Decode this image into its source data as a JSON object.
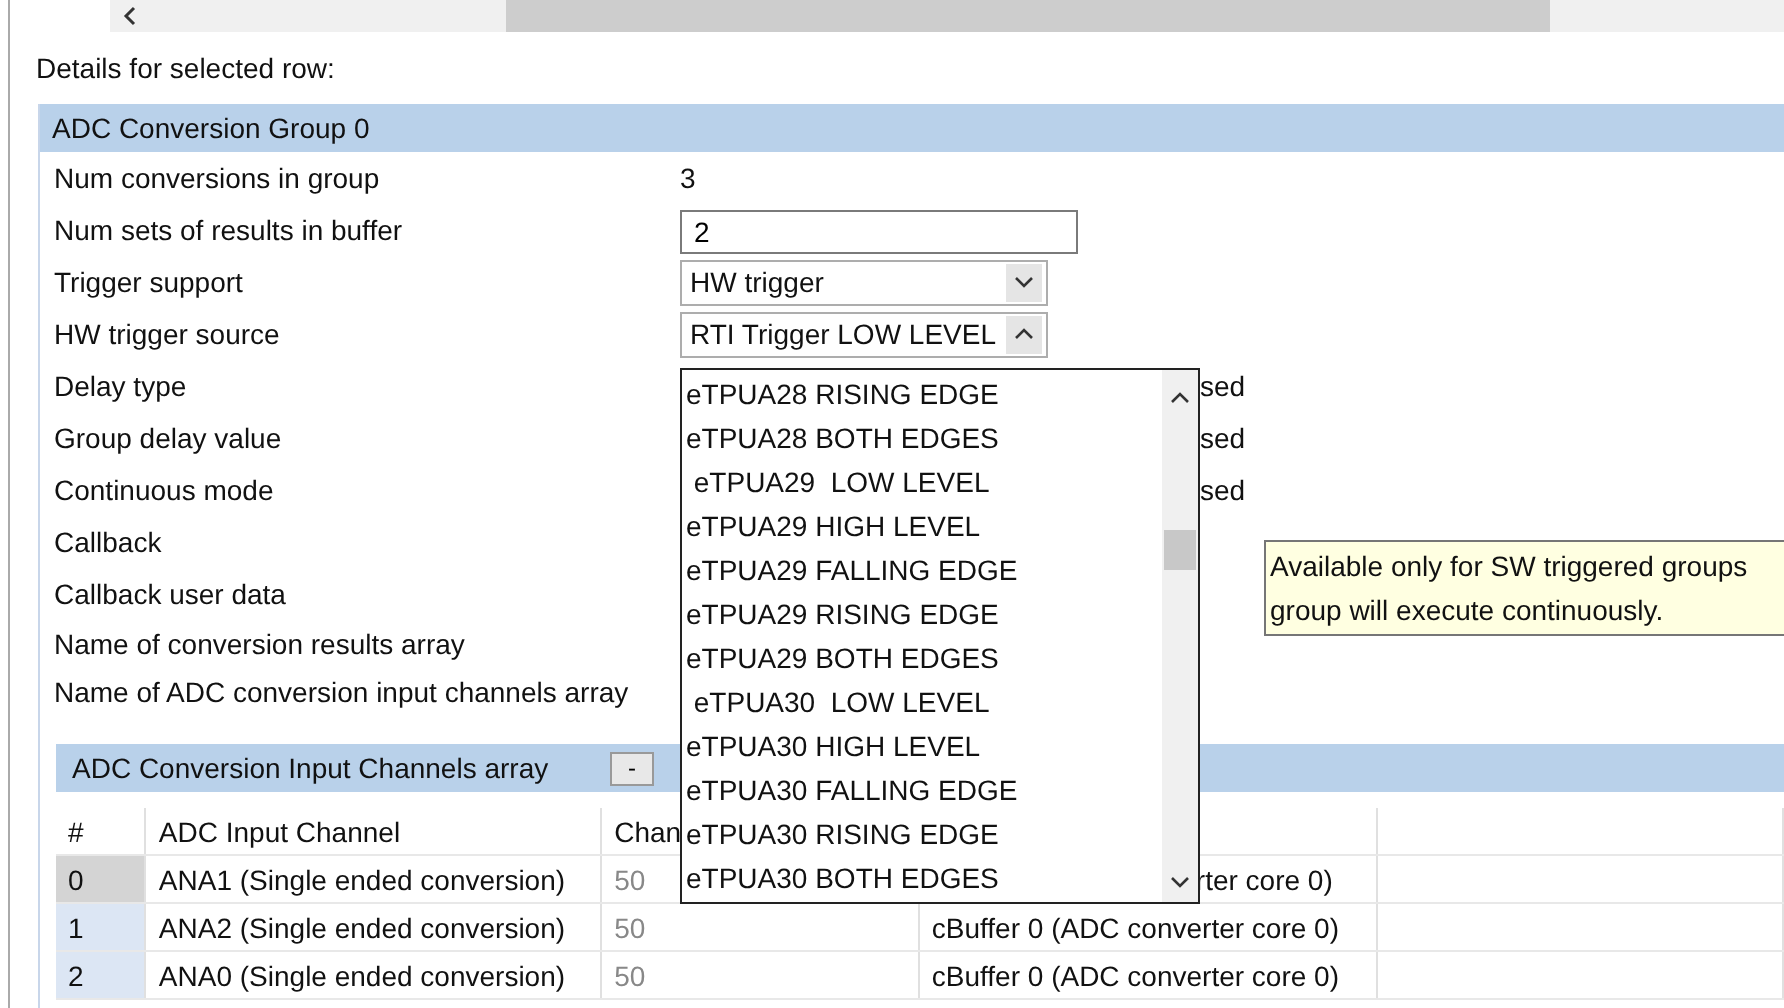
{
  "heading": "Details for selected row:",
  "group": {
    "title": "ADC Conversion Group 0",
    "fields": [
      {
        "label": "Num conversions in group",
        "kind": "text",
        "value": "3"
      },
      {
        "label": "Num sets of results in buffer",
        "kind": "input",
        "value": "2"
      },
      {
        "label": "Trigger support",
        "kind": "combo",
        "value": "HW trigger",
        "expanded": false
      },
      {
        "label": "HW trigger source",
        "kind": "combo",
        "value": "RTI Trigger  LOW LEVEL",
        "expanded": true
      },
      {
        "label": "Delay type",
        "kind": "hidden",
        "value": "sed"
      },
      {
        "label": "Group delay value",
        "kind": "hidden",
        "value": "sed"
      },
      {
        "label": "Continuous mode",
        "kind": "hidden",
        "value": "sed"
      },
      {
        "label": "Callback",
        "kind": "none"
      },
      {
        "label": "Callback user data",
        "kind": "none"
      },
      {
        "label": "Name of conversion results array",
        "kind": "none"
      },
      {
        "label": "Name of ADC conversion input channels array",
        "kind": "none"
      }
    ]
  },
  "dropdown": {
    "items": [
      "eTPUA28 RISING EDGE",
      "eTPUA28 BOTH EDGES",
      " eTPUA29  LOW LEVEL",
      "eTPUA29 HIGH LEVEL",
      "eTPUA29 FALLING EDGE",
      "eTPUA29 RISING EDGE",
      "eTPUA29 BOTH EDGES",
      " eTPUA30  LOW LEVEL",
      "eTPUA30 HIGH LEVEL",
      "eTPUA30 FALLING EDGE",
      "eTPUA30 RISING EDGE",
      "eTPUA30 BOTH EDGES"
    ]
  },
  "tooltip": {
    "lines": [
      "Available only for SW triggered groups",
      "group will execute continuously."
    ]
  },
  "channels": {
    "title": "ADC Conversion Input Channels array",
    "collapse_button": "-",
    "columns": [
      "#",
      "ADC Input Channel",
      "Chan"
    ],
    "rows": [
      {
        "index": "0",
        "channel": "ANA1 (Single ended conversion)",
        "column_3": "50",
        "column_4": "rter core 0)",
        "selected": true
      },
      {
        "index": "1",
        "channel": "ANA2 (Single ended conversion)",
        "column_3": "50",
        "column_4": "cBuffer 0 (ADC converter core 0)",
        "selected": false
      },
      {
        "index": "2",
        "channel": "ANA0 (Single ended conversion)",
        "column_3": "50",
        "column_4": "cBuffer 0 (ADC converter core 0)",
        "selected": false
      }
    ]
  }
}
